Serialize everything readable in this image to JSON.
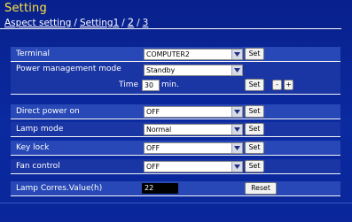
{
  "page": {
    "title": "Setting",
    "nav": {
      "aspect": "Aspect setting",
      "sep1": "/",
      "setting1": "Setting1",
      "sep2": "/",
      "current": "2",
      "sep3": "/",
      "next": "3"
    }
  },
  "rows": {
    "terminal": {
      "label": "Terminal",
      "value": "COMPUTER2",
      "button": "Set"
    },
    "power": {
      "label": "Power management mode",
      "value": "Standby",
      "time_label": "Time",
      "time_value": "30",
      "time_unit": "min.",
      "button": "Set",
      "minus": "-",
      "plus": "+"
    },
    "direct_power": {
      "label": "Direct power on",
      "value": "OFF",
      "button": "Set"
    },
    "lamp_mode": {
      "label": "Lamp mode",
      "value": "Normal",
      "button": "Set"
    },
    "key_lock": {
      "label": "Key lock",
      "value": "OFF",
      "button": "Set"
    },
    "fan_control": {
      "label": "Fan control",
      "value": "OFF",
      "button": "Set"
    },
    "lamp_corres": {
      "label": "Lamp Corres.Value(h)",
      "value": "22",
      "button": "Reset"
    }
  },
  "icons": {
    "dropdown": "chevron-down-icon"
  },
  "colors": {
    "title": "#ffe33a",
    "background": "#0b2aa0",
    "row_light": "#2748b6",
    "row_dark": "#1a35a4"
  }
}
